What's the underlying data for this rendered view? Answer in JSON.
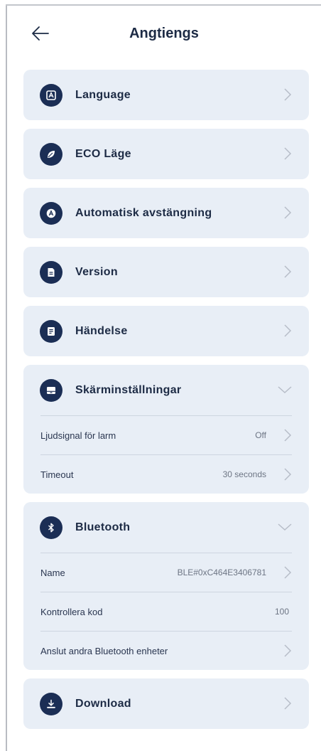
{
  "header": {
    "title": "Angtiengs"
  },
  "menu": [
    {
      "label": "Language",
      "icon": "language-icon"
    },
    {
      "label": "ECO Läge",
      "icon": "leaf-icon"
    },
    {
      "label": "Automatisk avstängning",
      "icon": "auto-off-icon"
    },
    {
      "label": "Version",
      "icon": "document-icon"
    },
    {
      "label": "Händelse",
      "icon": "event-icon"
    }
  ],
  "screen": {
    "label": "Skärminställningar",
    "icon": "monitor-icon",
    "rows": [
      {
        "label": "Ljudsignal för larm",
        "value": "Off"
      },
      {
        "label": "Timeout",
        "value": "30 seconds"
      }
    ]
  },
  "bluetooth": {
    "label": "Bluetooth",
    "icon": "bluetooth-icon",
    "rows": [
      {
        "label": "Name",
        "value": "BLE#0xC464E3406781"
      },
      {
        "label": "Kontrollera kod",
        "value": "100"
      },
      {
        "label": "Anslut andra Bluetooth enheter",
        "value": ""
      }
    ]
  },
  "download": {
    "label": "Download",
    "icon": "download-icon"
  },
  "colors": {
    "card": "#e8eef6",
    "icon_bg": "#1b2e55",
    "text": "#1d2b45",
    "chevron": "#b7bdc8"
  }
}
